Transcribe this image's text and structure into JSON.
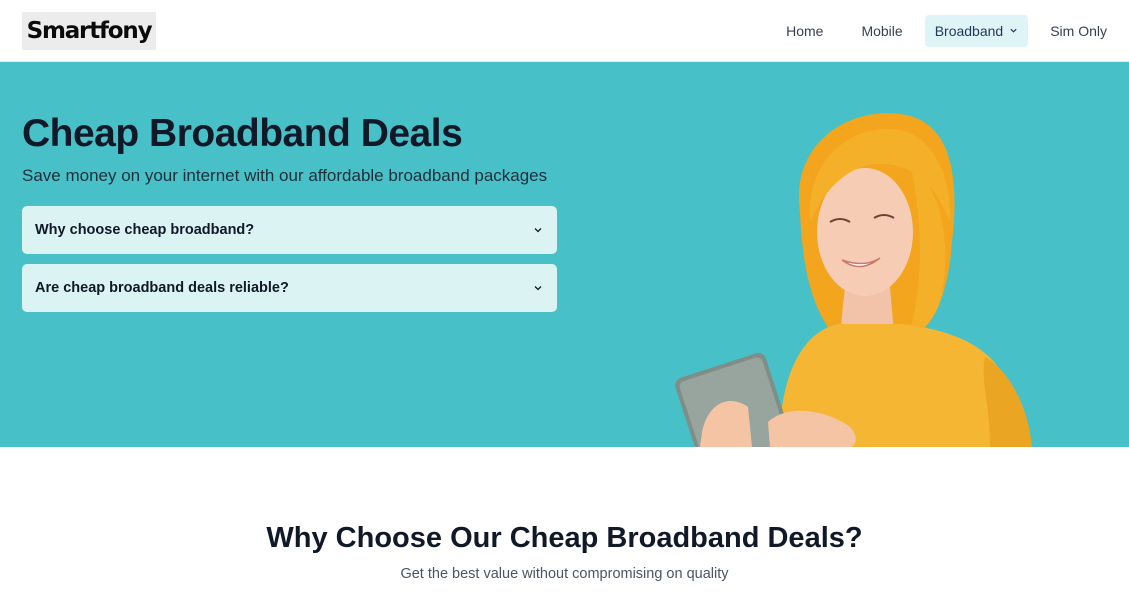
{
  "header": {
    "logo_text": "Smartfony",
    "nav": [
      {
        "label": "Home"
      },
      {
        "label": "Mobile"
      },
      {
        "label": "Broadband"
      },
      {
        "label": "Sim Only"
      }
    ]
  },
  "hero": {
    "title": "Cheap Broadband Deals",
    "subtitle": "Save money on your internet with our affordable broadband packages",
    "faqs": [
      {
        "question": "Why choose cheap broadband?",
        "icon": "chevron-down-icon"
      },
      {
        "question": "Are cheap broadband deals reliable?",
        "icon": "chevron-down-icon"
      }
    ],
    "image": "woman-with-tablet-photo"
  },
  "section": {
    "title": "Why Choose Our Cheap Broadband Deals?",
    "subtitle": "Get the best value without compromising on quality"
  },
  "colors": {
    "hero_bg": "#48c0c8",
    "faq_bg": "#dcf3f4",
    "active_nav_bg": "#dff4f6",
    "text_dark": "#111827"
  }
}
